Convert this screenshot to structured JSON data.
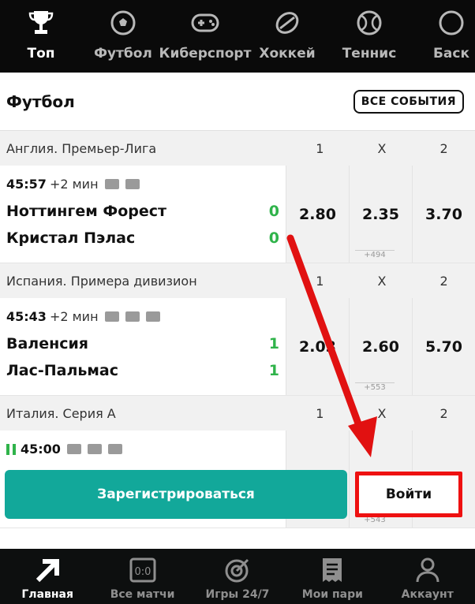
{
  "topnav": {
    "tabs": [
      {
        "label": "Топ",
        "icon": "trophy-icon"
      },
      {
        "label": "Футбол",
        "icon": "soccer-ball-icon"
      },
      {
        "label": "Киберспорт",
        "icon": "gamepad-icon"
      },
      {
        "label": "Хоккей",
        "icon": "hockey-puck-icon"
      },
      {
        "label": "Теннис",
        "icon": "tennis-ball-icon"
      },
      {
        "label": "Баск",
        "icon": "basketball-icon"
      }
    ]
  },
  "section": {
    "title": "Футбол",
    "all_events": "ВСЕ СОБЫТИЯ"
  },
  "leagues": [
    {
      "name": "Англия. Премьер-Лига",
      "cols": [
        "1",
        "X",
        "2"
      ],
      "match": {
        "time": "45:57",
        "extra": "+2 мин",
        "team1": "Ноттингем Форест",
        "team2": "Кристал Пэлас",
        "score1": "0",
        "score2": "0",
        "odds": [
          "2.80",
          "2.35",
          "3.70"
        ],
        "more": "+494"
      }
    },
    {
      "name": "Испания. Примера дивизион",
      "cols": [
        "1",
        "X",
        "2"
      ],
      "match": {
        "time": "45:43",
        "extra": "+2 мин",
        "team1": "Валенсия",
        "team2": "Лас-Пальмас",
        "score1": "1",
        "score2": "1",
        "odds": [
          "2.03",
          "2.60",
          "5.70"
        ],
        "more": "+553"
      }
    },
    {
      "name": "Италия. Серия А",
      "cols": [
        "1",
        "X",
        "2"
      ],
      "match": {
        "time": "45:00",
        "more": "+543"
      }
    }
  ],
  "actions": {
    "register": "Зарегистрироваться",
    "login": "Войти"
  },
  "bottomnav": {
    "items": [
      {
        "label": "Главная",
        "icon": "home-arrow-icon"
      },
      {
        "label": "Все матчи",
        "icon": "scoreboard-icon"
      },
      {
        "label": "Игры 24/7",
        "icon": "target-icon"
      },
      {
        "label": "Мои пари",
        "icon": "receipt-icon"
      },
      {
        "label": "Аккаунт",
        "icon": "user-icon"
      }
    ]
  },
  "colors": {
    "accent_green": "#2fb34a",
    "register_teal": "#12a89a",
    "highlight_red": "#e11111"
  }
}
